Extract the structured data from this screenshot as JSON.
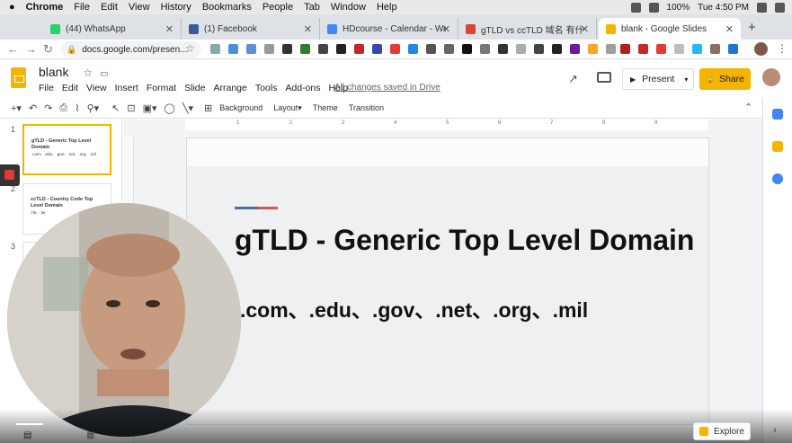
{
  "mac_menu": {
    "app": "Chrome",
    "items": [
      "File",
      "Edit",
      "View",
      "History",
      "Bookmarks",
      "People",
      "Tab",
      "Window",
      "Help"
    ],
    "battery": "100%",
    "clock": "Tue 4:50 PM"
  },
  "tabs": [
    {
      "label": "(44) WhatsApp",
      "color": "#25d366"
    },
    {
      "label": "(1) Facebook",
      "color": "#3b5998"
    },
    {
      "label": "HDcourse - Calendar - Week of",
      "color": "#4285f4"
    },
    {
      "label": "gTLD vs ccTLD 域名 有什麼不同",
      "color": "#db4437"
    },
    {
      "label": "blank - Google Slides",
      "color": "#f4b400"
    }
  ],
  "address": {
    "url": "docs.google.com/presen..."
  },
  "doc": {
    "title": "blank",
    "menus": [
      "File",
      "Edit",
      "View",
      "Insert",
      "Format",
      "Slide",
      "Arrange",
      "Tools",
      "Add-ons",
      "Help"
    ],
    "saved_status": "All changes saved in Drive",
    "present_label": "Present",
    "share_label": "Share"
  },
  "toolbar": {
    "background": "Background",
    "layout": "Layout▾",
    "theme": "Theme",
    "transition": "Transition"
  },
  "filmstrip": [
    {
      "num": "1",
      "title": "gTLD - Generic Top Level Domain",
      "sub": ".com、.edu、.gov、.net、.org、.mil"
    },
    {
      "num": "2",
      "title": "ccTLD - Country Code Top Level Domain",
      "sub": ".hk、.tw"
    },
    {
      "num": "3",
      "title": "",
      "sub": ""
    }
  ],
  "ruler": {
    "marks": [
      "1",
      "2",
      "3",
      "4",
      "5",
      "6",
      "7",
      "8",
      "9"
    ]
  },
  "slide": {
    "title": "gTLD - Generic Top Level Domain",
    "subtitle": ".com、.edu、.gov、.net、.org、.mil",
    "accent_colors": [
      "#4a6fa5",
      "#d9534f"
    ]
  },
  "explore_label": "Explore"
}
